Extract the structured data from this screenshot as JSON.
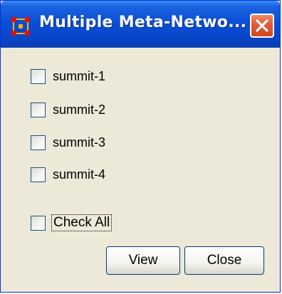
{
  "window": {
    "title": "Multiple Meta-Netwo...",
    "close_icon": "close-x-icon",
    "app_icon": "network-nodes-icon"
  },
  "checkboxes": [
    {
      "label": "summit-1",
      "checked": false
    },
    {
      "label": "summit-2",
      "checked": false
    },
    {
      "label": "summit-3",
      "checked": false
    },
    {
      "label": "summit-4",
      "checked": false
    }
  ],
  "check_all": {
    "label": "Check All",
    "checked": false
  },
  "buttons": {
    "view_label": "View",
    "close_label": "Close"
  },
  "colors": {
    "titlebar": "#0a4fd6",
    "close_button": "#e25a36",
    "dialog_background": "#ece9d8",
    "checkbox_border": "#1c5180"
  }
}
